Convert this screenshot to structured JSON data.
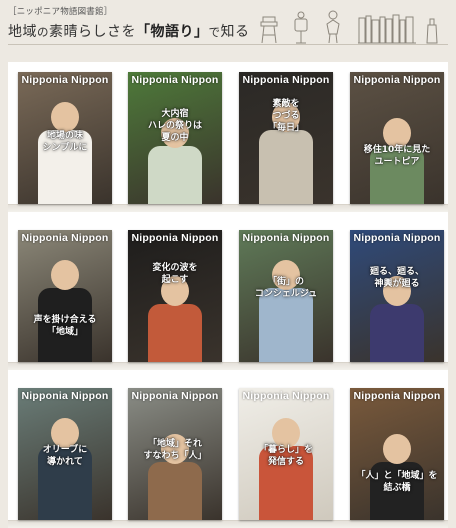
{
  "header": {
    "library_label": "［ニッポニア物語図書館］",
    "title_lead": "地域",
    "title_no": "の",
    "title_mid": "素晴らしさを",
    "title_bracket_open": "「",
    "title_emph": "物語り",
    "title_bracket_close": "」",
    "title_de": "で",
    "title_tail": "知る"
  },
  "brand_name": "Nipponia Nippon",
  "cards": [
    {
      "caption": "地場の味\nシンプルに",
      "bg": "#7a6a58"
    },
    {
      "caption": "大内宿\nハレの祭りは\n夏の中",
      "bg": "#4e7a3a"
    },
    {
      "caption": "素敵を\nつづる\n「毎日」",
      "bg": "#2b2926"
    },
    {
      "caption": "移住10年に見た\nユートピア",
      "bg": "#5c5144"
    },
    {
      "caption": "声を掛け合える\n「地域」",
      "bg": "#8b8778"
    },
    {
      "caption": "変化の波を\n起こす",
      "bg": "#1e1d1c"
    },
    {
      "caption": "「街」の\nコンシェルジュ",
      "bg": "#5f7a58"
    },
    {
      "caption": "廻る、廻る、\n神輿が廻る",
      "bg": "#2f4a7a"
    },
    {
      "caption": "オリーブに\n導かれて",
      "bg": "#6a7d78"
    },
    {
      "caption": "「地域」それ\nすなわち「人」",
      "bg": "#8a8d86"
    },
    {
      "caption": "「暮らし」を\n発信する",
      "bg": "#e6e4de"
    },
    {
      "caption": "「人」と「地域」を\n結ぶ橋",
      "bg": "#7a5a3c"
    }
  ]
}
